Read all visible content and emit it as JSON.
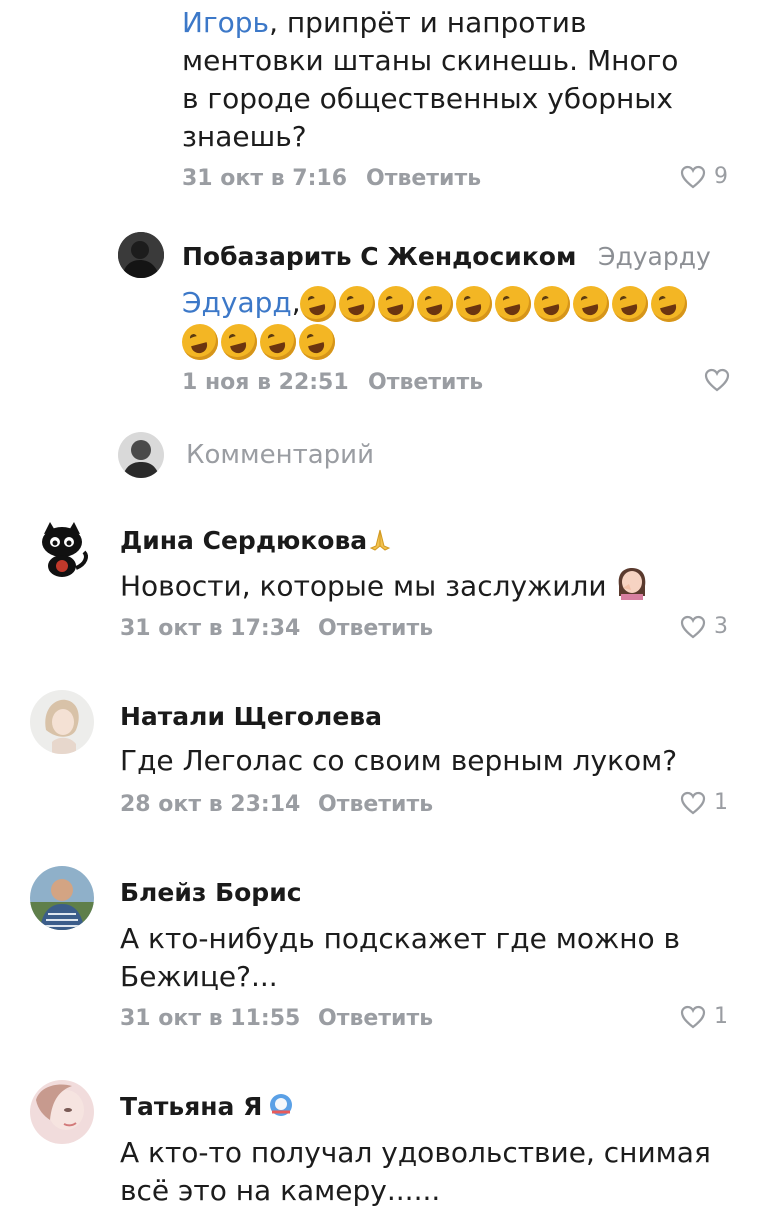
{
  "comments": [
    {
      "mention": "Игорь",
      "text_lines": [
        ", припрёт и напротив",
        "ментовки штаны скинешь. Много",
        "в городе общественных уборных",
        "знаешь?"
      ],
      "date": "31 окт в 7:16",
      "reply_label": "Ответить",
      "likes": "9"
    },
    {
      "author": "Побазарить С Жендосиком",
      "reply_to": "Эдуарду",
      "mention": "Эдуард",
      "text_after_mention": ",",
      "emoji_name": "rolling-on-floor-laughing",
      "emoji_count_line1": 10,
      "emoji_count_line2": 4,
      "date": "1 ноя в 22:51",
      "reply_label": "Ответить",
      "likes": ""
    },
    {
      "author": "Дина Сердюкова",
      "author_emoji": "folded-hands",
      "text": "Новости, которые мы заслужили",
      "text_emoji": "woman-facepalming",
      "date": "31 окт в 17:34",
      "reply_label": "Ответить",
      "likes": "3"
    },
    {
      "author": "Натали Щеголева",
      "text": "Где Леголас со своим верным луком?",
      "date": "28 окт в 23:14",
      "reply_label": "Ответить",
      "likes": "1"
    },
    {
      "author": "Блейз Борис",
      "text_lines": [
        "А кто-нибудь подскажет где можно в",
        "Бежице?..."
      ],
      "date": "31 окт в 11:55",
      "reply_label": "Ответить",
      "likes": "1"
    },
    {
      "author": "Татьяна Я",
      "author_emoji": "blue-badge",
      "text_lines": [
        "А кто-то получал удовольствие, снимая",
        "всё это на камеру......"
      ]
    }
  ],
  "comment_input": {
    "placeholder": "Комментарий"
  },
  "colors": {
    "link": "#3c78c8",
    "meta": "#9a9da2",
    "text": "#1c1c1c"
  }
}
